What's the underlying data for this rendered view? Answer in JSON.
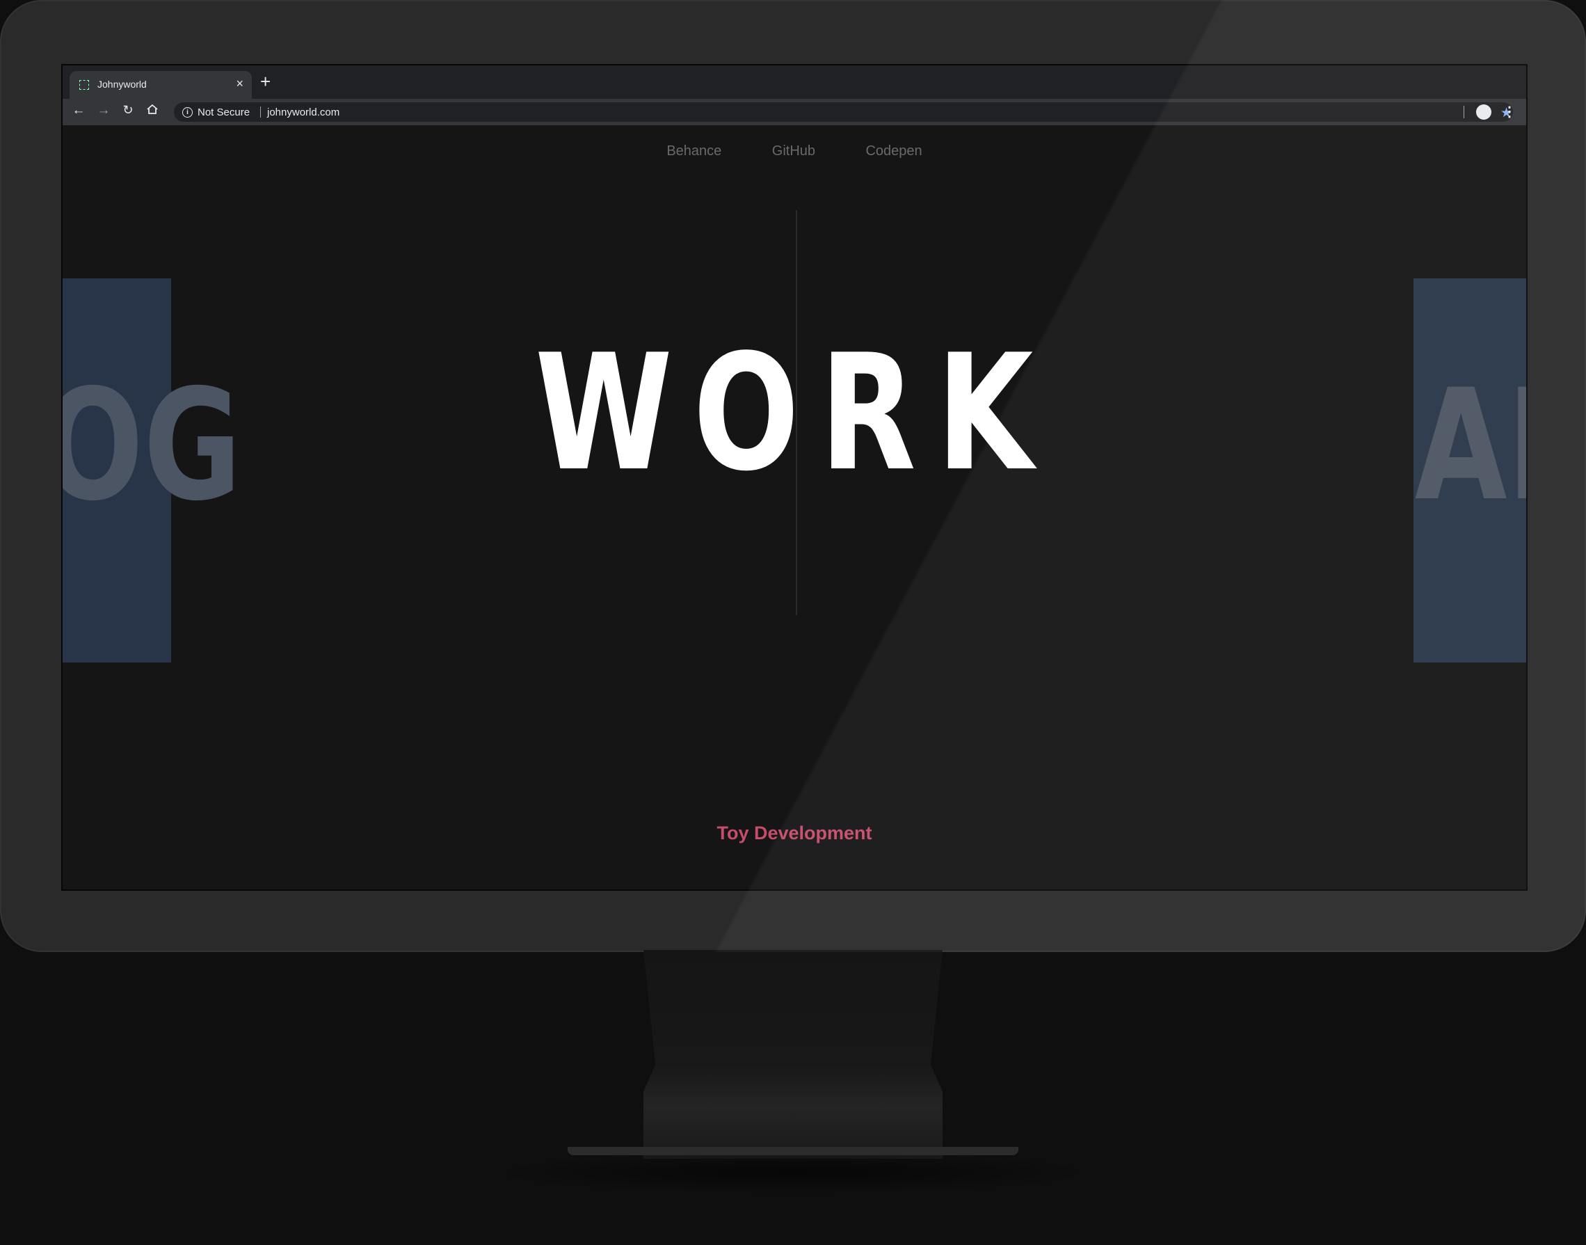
{
  "browser": {
    "tab_title": "Johnyworld",
    "new_tab": "+",
    "close": "×",
    "security_label": "Not Secure",
    "url": "johnyworld.com"
  },
  "icons": {
    "back": "arrow-left",
    "forward": "arrow-right",
    "reload": "reload",
    "home": "home",
    "info": "info",
    "bookmark": "star",
    "profile": "profile",
    "menu": "vertical-dots"
  },
  "nav": {
    "items": [
      {
        "label": "Behance"
      },
      {
        "label": "GitHub"
      },
      {
        "label": "Codepen"
      }
    ]
  },
  "hero": {
    "title": "WORK",
    "left_peek": "OG",
    "right_peek": "ABO",
    "subtitle": "Toy Development"
  },
  "colors": {
    "page_bg": "#151515",
    "panel": "#283548",
    "accent": "#c64c6c",
    "nav_text": "#6a6a6a"
  }
}
